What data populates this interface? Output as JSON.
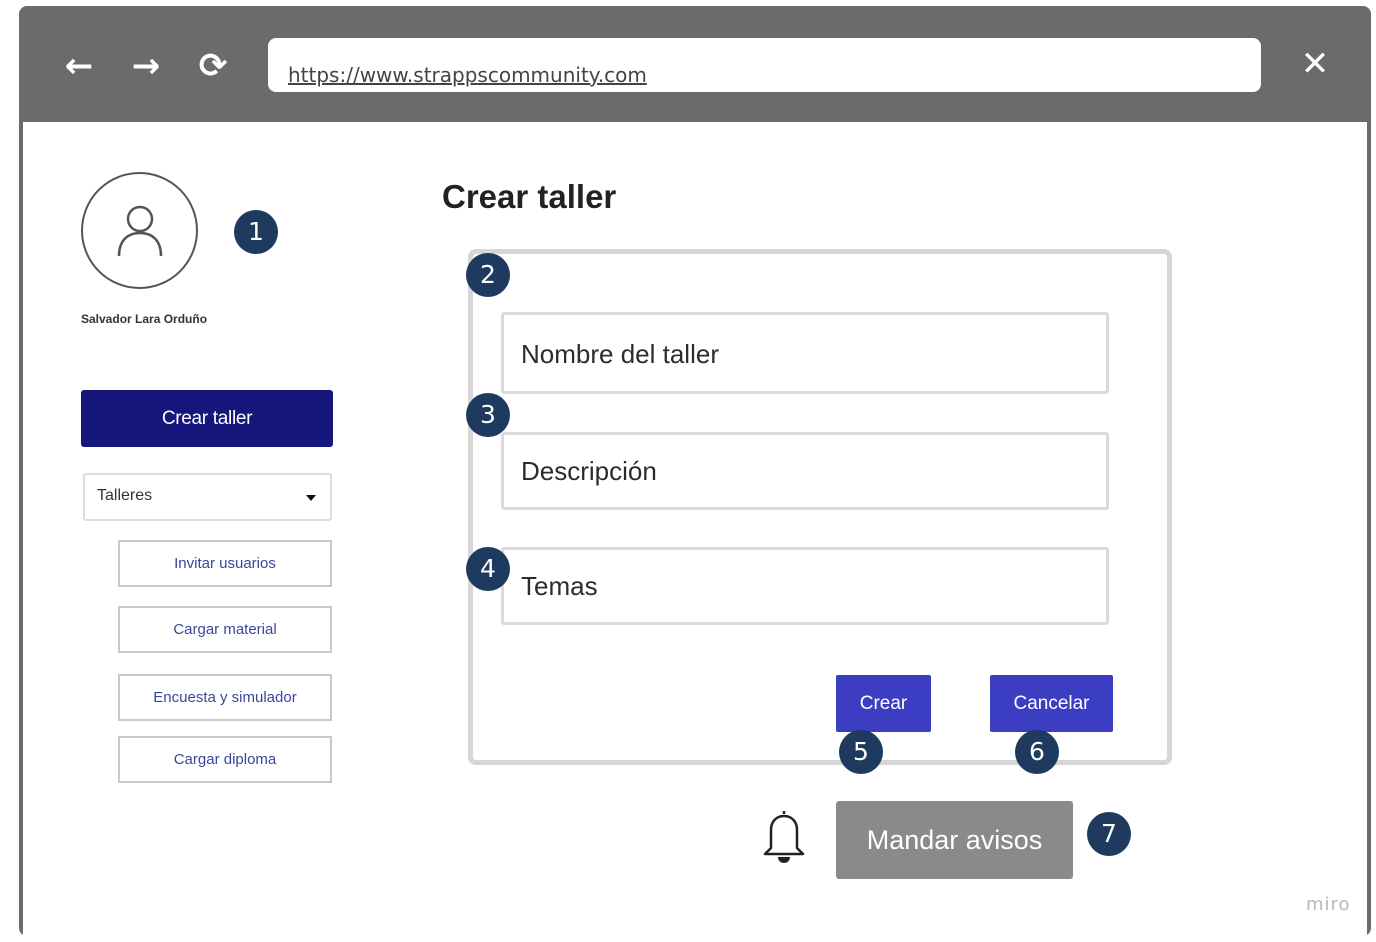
{
  "browser": {
    "back_icon": "←",
    "forward_icon": "→",
    "reload_icon": "⟳",
    "url": "https://www.strappscommunity.com",
    "close_icon": "✕"
  },
  "sidebar": {
    "user_name": "Salvador Lara Orduño",
    "create_button": "Crear taller",
    "select": {
      "selected": "Talleres"
    },
    "buttons": [
      "Invitar usuarios",
      "Cargar material",
      "Encuesta y simulador",
      "Cargar diploma"
    ]
  },
  "main": {
    "title": "Crear taller",
    "fields": {
      "name": "Nombre del taller",
      "description": "Descripción",
      "topics": "Temas"
    },
    "create_button": "Crear",
    "cancel_button": "Cancelar",
    "notify_button": "Mandar avisos"
  },
  "annotations": [
    "1",
    "2",
    "3",
    "4",
    "5",
    "6",
    "7"
  ],
  "watermark": "miro",
  "colors": {
    "primary_dark": "#16167d",
    "action_blue": "#3b3dc2",
    "badge": "#1f3a5f",
    "chrome_gray": "#6b6b6b",
    "notify_gray": "#8a8a8a"
  }
}
